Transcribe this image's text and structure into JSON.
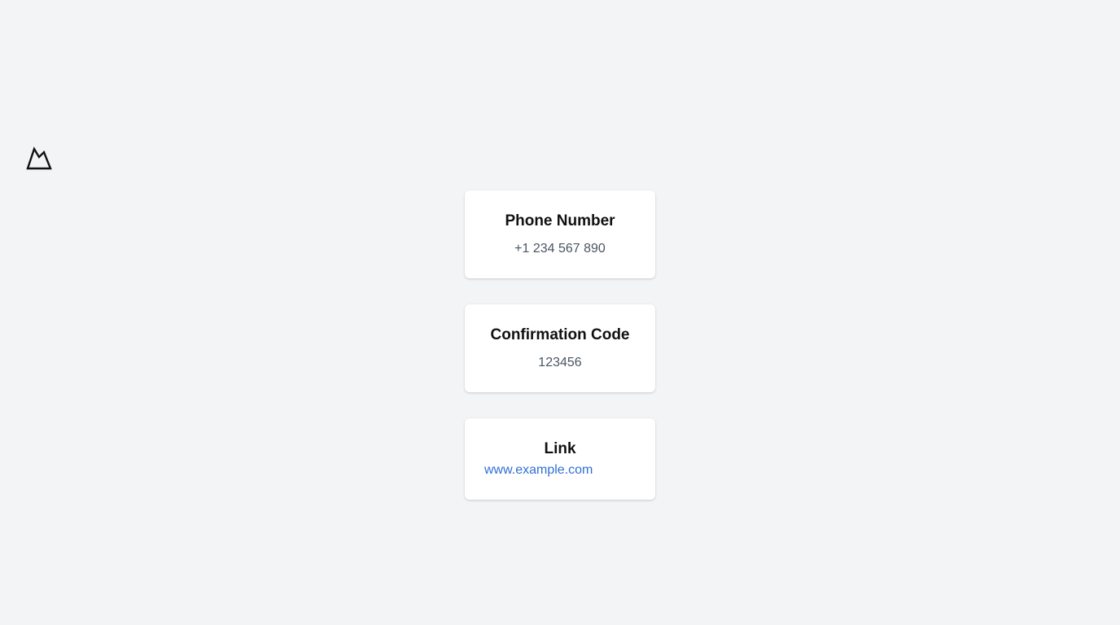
{
  "logo": {
    "icon": "mountain-logo-icon"
  },
  "cards": [
    {
      "title": "Phone Number",
      "value": "+1 234 567 890"
    },
    {
      "title": "Confirmation Code",
      "value": "123456"
    },
    {
      "title": "Link",
      "value": "www.example.com"
    }
  ],
  "colors": {
    "background": "#f3f4f6",
    "card": "#ffffff",
    "title": "#111111",
    "value": "#4b5563",
    "link": "#2f6fd4"
  }
}
